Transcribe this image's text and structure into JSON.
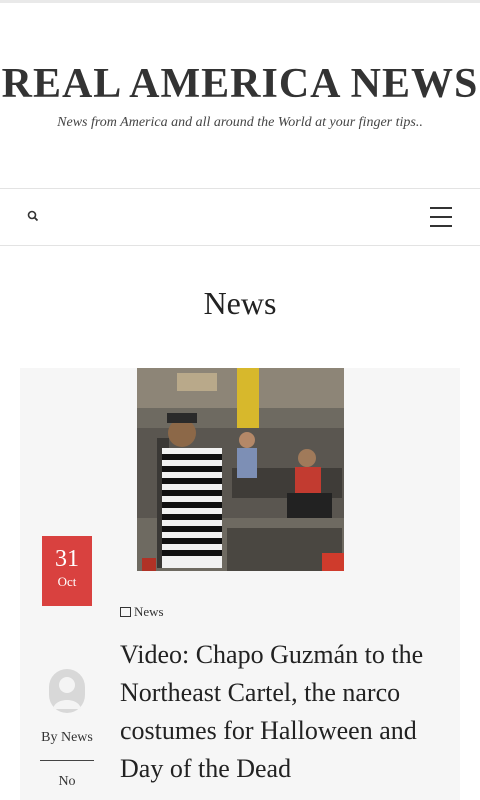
{
  "site": {
    "title": "REAL AMERICA NEWS",
    "tagline": "News from America and all around the World at your finger tips.."
  },
  "nav": {
    "search_icon": "search-icon",
    "menu_icon": "hamburger-menu-icon"
  },
  "page": {
    "heading": "News"
  },
  "post": {
    "date_day": "31",
    "date_month": "Oct",
    "category": "News",
    "title": "Video: Chapo Guzmán to the Northeast Cartel, the narco costumes for Halloween and Day of the Dead",
    "author_label": "By News",
    "comments": "No"
  },
  "colors": {
    "accent": "#d9413f",
    "card_bg": "#f6f6f6",
    "border": "#e3e3e3"
  }
}
